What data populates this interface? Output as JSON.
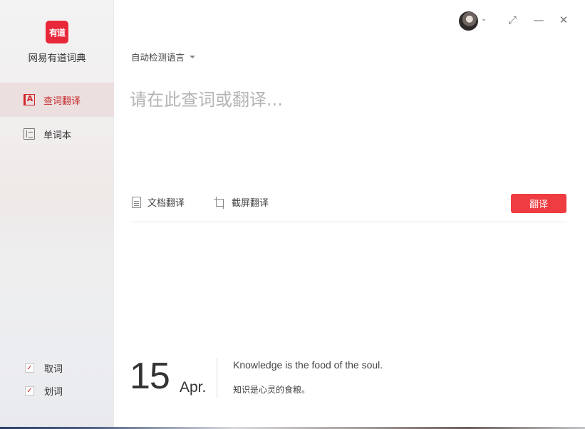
{
  "app": {
    "logo_text": "有道",
    "name": "网易有道词典"
  },
  "sidebar": {
    "items": [
      {
        "label": "查词翻译",
        "icon": "dictionary-a-icon",
        "active": true
      },
      {
        "label": "单词本",
        "icon": "wordbook-icon",
        "active": false
      }
    ],
    "options": [
      {
        "label": "取词",
        "checked": true
      },
      {
        "label": "划词",
        "checked": true
      }
    ]
  },
  "window": {
    "avatar_icon": "user-avatar",
    "caret": "⌄",
    "restore": "⤢",
    "minimize": "—",
    "close": "✕"
  },
  "search": {
    "language_label": "自动检测语言",
    "placeholder": "请在此查词或翻译..."
  },
  "tools": {
    "doc_translate": "文档翻译",
    "screen_translate": "截屏翻译",
    "translate_button": "翻译"
  },
  "daily": {
    "day": "15",
    "month": "Apr.",
    "quote_en": "Knowledge is the food of the soul.",
    "quote_zh": "知识是心灵的食粮。"
  },
  "colors": {
    "accent": "#ee3c40",
    "brand": "#e8283a",
    "active_text": "#c6282b"
  }
}
